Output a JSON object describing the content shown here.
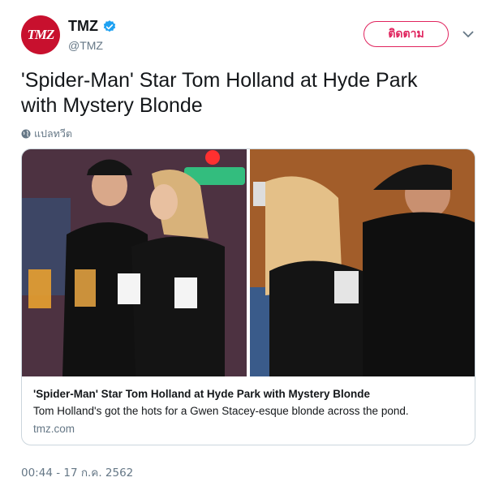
{
  "author": {
    "display_name": "TMZ",
    "handle": "@TMZ",
    "avatar_text": "TMZ",
    "verified": true
  },
  "header": {
    "follow_label": "ติดตาม",
    "menu_icon": "chevron-down-icon"
  },
  "tweet": {
    "text_line1": "'Spider-Man' Star Tom Holland at Hyde Park",
    "text_line2": "with Mystery Blonde",
    "translate_label": "แปลทวีต",
    "timestamp": "00:44 - 17 ก.ค. 2562"
  },
  "card": {
    "title": "'Spider-Man' Star Tom Holland at Hyde Park with Mystery Blonde",
    "description": "Tom Holland's got the hots for a Gwen Stacey-esque blonde across the pond.",
    "domain": "tmz.com"
  },
  "colors": {
    "brand_red": "#c8102e",
    "follow_pink": "#e0245e",
    "verified_blue": "#1da1f2",
    "muted_gray": "#657786",
    "border": "#ccd6dd"
  }
}
